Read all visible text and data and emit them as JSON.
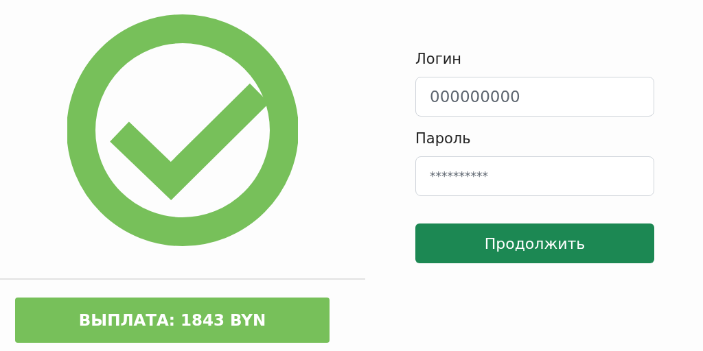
{
  "payout_button": {
    "label": "ВЫПЛАТА: 1843 BYN"
  },
  "login": {
    "label": "Логин",
    "value": "000000000"
  },
  "password": {
    "label": "Пароль",
    "value": "**********"
  },
  "continue_button": {
    "label": "Продолжить"
  }
}
